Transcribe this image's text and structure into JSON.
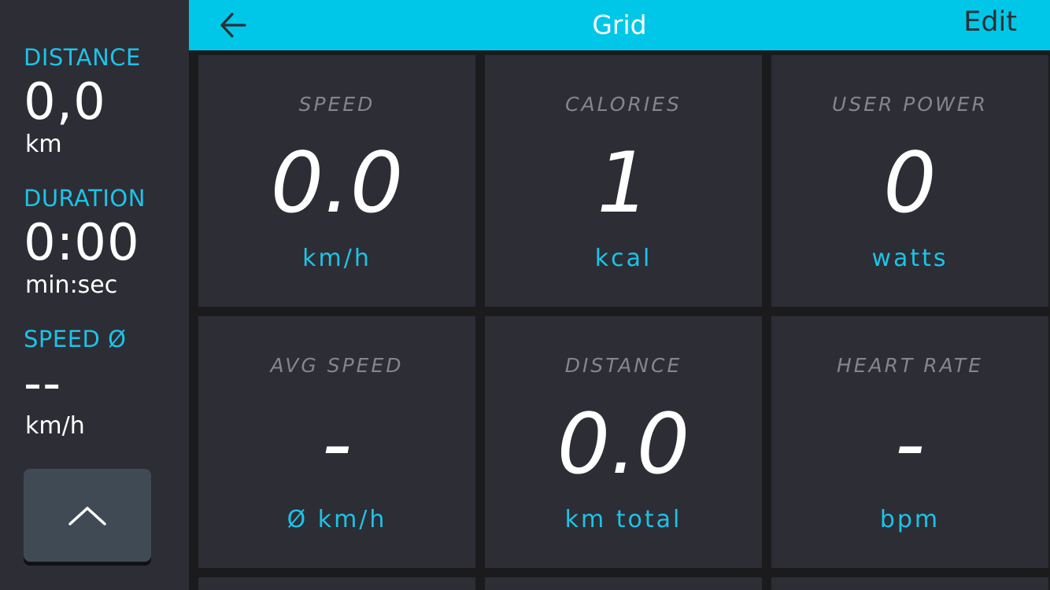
{
  "sidebar": {
    "distance": {
      "label": "DISTANCE",
      "value": "0,0",
      "unit": "km"
    },
    "duration": {
      "label": "DURATION",
      "value": "0:00",
      "unit": "min:sec"
    },
    "avg_speed": {
      "label": "SPEED Ø",
      "value": "--",
      "unit": "km/h"
    },
    "collapse_icon": "chevron-up-icon"
  },
  "header": {
    "back_icon": "arrow-left-icon",
    "title": "Grid",
    "edit_label": "Edit"
  },
  "tiles": [
    {
      "title": "SPEED",
      "value": "0.0",
      "unit": "km/h"
    },
    {
      "title": "CALORIES",
      "value": "1",
      "unit": "kcal"
    },
    {
      "title": "USER POWER",
      "value": "0",
      "unit": "watts"
    },
    {
      "title": "AVG SPEED",
      "value": "-",
      "unit": "Ø km/h"
    },
    {
      "title": "DISTANCE",
      "value": "0.0",
      "unit": "km total"
    },
    {
      "title": "HEART RATE",
      "value": "-",
      "unit": "bpm"
    }
  ],
  "colors": {
    "accent": "#00c7e7",
    "label_cyan": "#1cc3e8",
    "panel": "#2d2d35",
    "background": "#1b1b1e",
    "button": "#404a54"
  }
}
